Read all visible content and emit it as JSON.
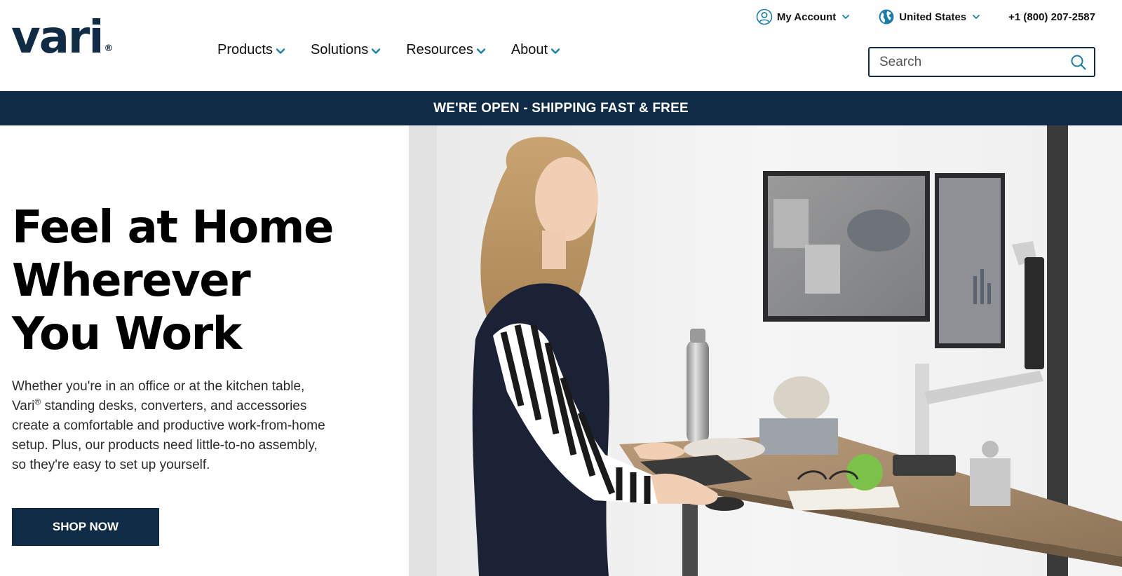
{
  "brand": {
    "logo_text": "vari",
    "logo_mark": "®"
  },
  "nav": {
    "items": [
      {
        "label": "Products"
      },
      {
        "label": "Solutions"
      },
      {
        "label": "Resources"
      },
      {
        "label": "About"
      }
    ]
  },
  "utility": {
    "account_label": "My Account",
    "account_icon": "user-circle-icon",
    "region_label": "United States",
    "region_icon": "globe-icon",
    "phone": "+1 (800) 207-2587"
  },
  "search": {
    "placeholder": "Search",
    "value": "",
    "icon": "search-icon"
  },
  "banner": {
    "text": "WE'RE OPEN - SHIPPING FAST & FREE"
  },
  "hero": {
    "headline_lines": [
      "Feel at Home",
      "Wherever",
      "You Work"
    ],
    "body_part1": "Whether you're in an office or at the kitchen table, Vari",
    "body_mark": "®",
    "body_part2": " standing desks, converters, and accessories create a comfortable and productive work-from-home setup. Plus, our products need little-to-no assembly, so they're easy to set up yourself.",
    "cta_label": "SHOP NOW"
  },
  "colors": {
    "brand_navy": "#0f2b46",
    "accent_teal": "#1a7fa8",
    "text_dark": "#111111"
  }
}
